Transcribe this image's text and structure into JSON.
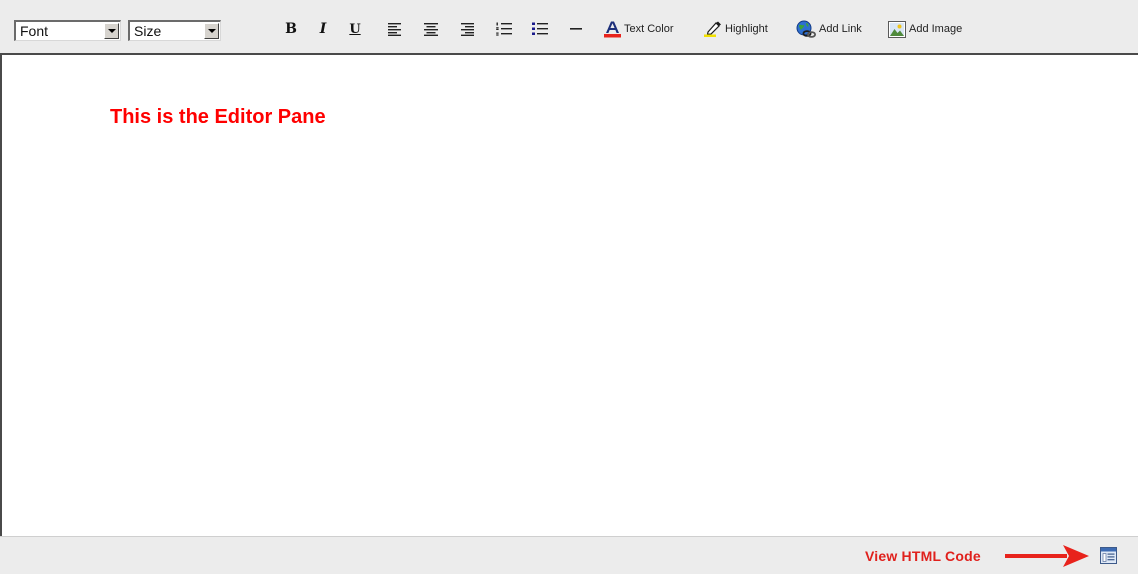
{
  "toolbar": {
    "font_select": {
      "value": "Font"
    },
    "size_select": {
      "value": "Size"
    },
    "bold_label": "B",
    "italic_label": "I",
    "underline_label": "U",
    "text_color_label": "Text Color",
    "highlight_label": "Highlight",
    "add_link_label": "Add Link",
    "add_image_label": "Add Image",
    "icons": {
      "align_left": "align-left-icon",
      "align_center": "align-center-icon",
      "align_right": "align-right-icon",
      "ordered_list": "ordered-list-icon",
      "unordered_list": "unordered-list-icon",
      "horizontal_rule": "horizontal-rule-icon",
      "text_color": "text-color-icon",
      "highlight": "highlighter-icon",
      "add_link": "globe-link-icon",
      "add_image": "image-icon"
    }
  },
  "editor": {
    "content": "This is the Editor Pane"
  },
  "footer": {
    "view_html_label": "View HTML Code",
    "view_html_icon": "source-view-icon"
  },
  "colors": {
    "toolbar_bg": "#ececec",
    "editor_text": "#ff0000",
    "annotation": "#e0201c",
    "text_color_bar": "#e8231c",
    "highlight_bar": "#f2e100"
  }
}
